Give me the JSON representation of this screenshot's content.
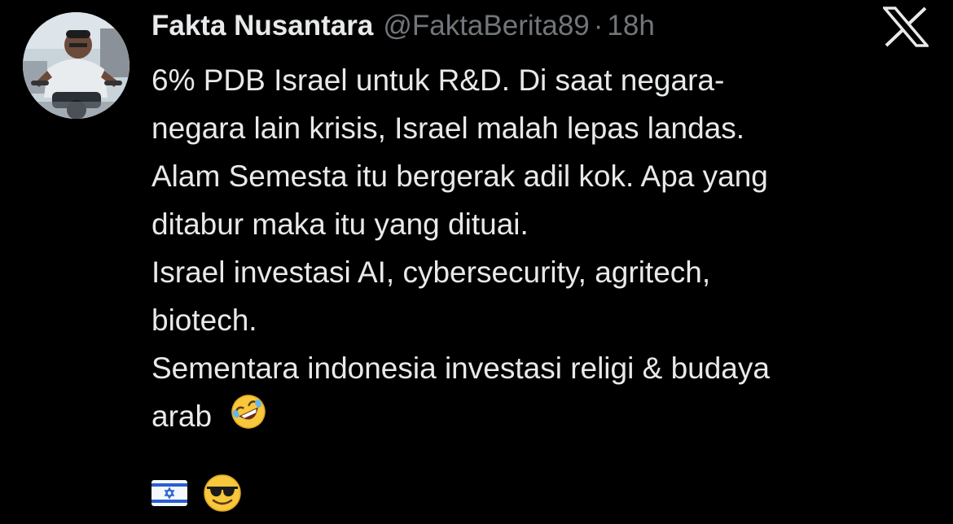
{
  "author": {
    "display_name": "Fakta Nusantara",
    "handle": "@FaktaBerita89",
    "separator": "·",
    "time": "18h"
  },
  "tweet_lines": [
    "6% PDB Israel untuk R&D. Di saat negara-",
    "negara lain krisis, Israel malah lepas landas.",
    "Alam Semesta itu bergerak adil kok. Apa yang",
    "ditabur maka itu yang dituai.",
    "Israel investasi AI, cybersecurity, agritech,",
    "biotech.",
    "Sementara indonesia investasi religi & budaya",
    "arab"
  ],
  "icons": {
    "platform_logo": "x-logo-icon",
    "laughing_emoji": "rolling-on-floor-laughing-emoji",
    "flag_emoji": "israel-flag-emoji",
    "sunglasses_emoji": "smiling-face-with-sunglasses-emoji"
  },
  "colors": {
    "background": "#000000",
    "primary_text": "#e7e9ea",
    "secondary_text": "#71767b"
  }
}
